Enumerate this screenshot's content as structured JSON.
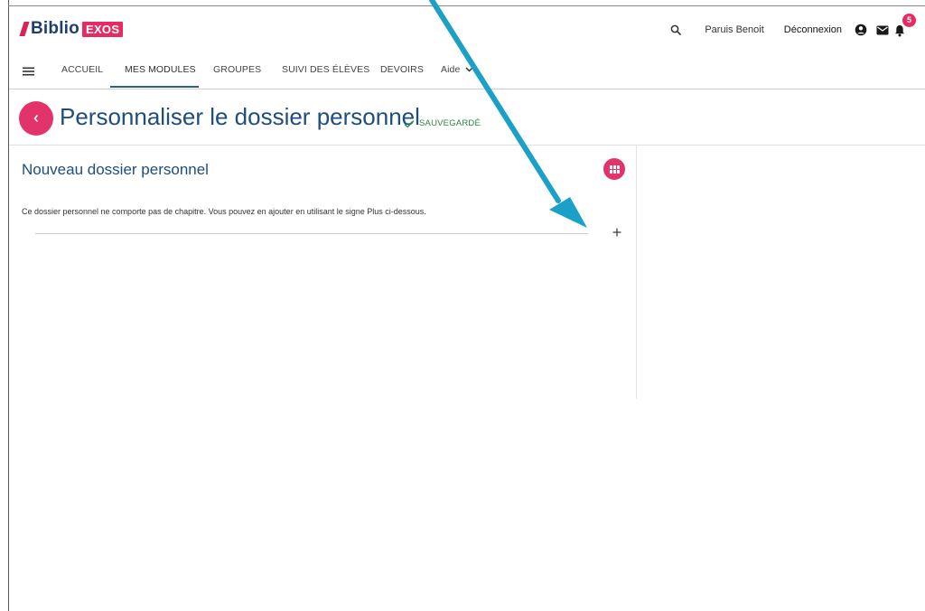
{
  "header": {
    "logo_text": "Biblio",
    "logo_badge": "EXOS",
    "user_name": "Paruis Benoit",
    "logout_label": "Déconnexion",
    "notification_count": "5"
  },
  "nav": {
    "items": [
      {
        "label": "ACCUEIL"
      },
      {
        "label": "MES MODULES"
      },
      {
        "label": "GROUPES"
      },
      {
        "label": "SUIVI DES ÉLÈVES"
      },
      {
        "label": "DEVOIRS"
      },
      {
        "label": "Aide"
      }
    ],
    "active": "MES MODULES"
  },
  "page": {
    "title": "Personnaliser le dossier personnel",
    "saved_label": "SAUVEGARDÉ"
  },
  "folder": {
    "title": "Nouveau dossier personnel",
    "info": "Ce dossier personnel ne comporte pas de chapitre. Vous pouvez en ajouter en utilisant le signe Plus ci-dessous."
  },
  "colors": {
    "brand_pink": "#e2336b",
    "brand_navy": "#1d4e7e",
    "success_green": "#2e8540",
    "annotation_arrow": "#1ba0c8"
  },
  "icons": [
    "menu-icon",
    "search-icon",
    "account-icon",
    "mail-icon",
    "bell-icon",
    "chevron-down-icon",
    "back-arrow-icon",
    "check-icon",
    "grid-icon",
    "plus-icon"
  ]
}
